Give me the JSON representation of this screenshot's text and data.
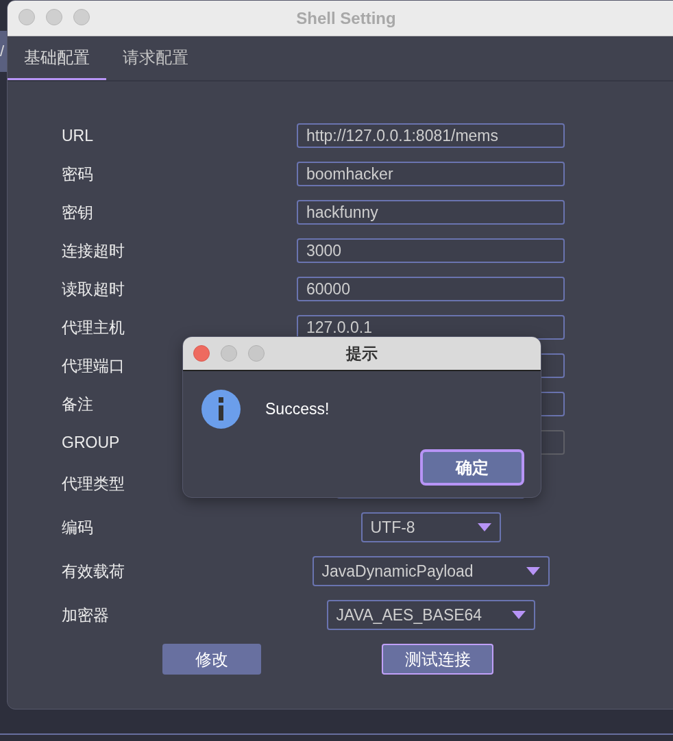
{
  "backdrop": {
    "text": "/"
  },
  "window": {
    "title": "Shell Setting"
  },
  "tabs": [
    {
      "label": "基础配置",
      "selected": true
    },
    {
      "label": "请求配置",
      "selected": false
    }
  ],
  "fields": [
    {
      "kind": "text",
      "label": "URL",
      "value": "http://127.0.0.1:8081/mems",
      "disabled": false
    },
    {
      "kind": "text",
      "label": "密码",
      "value": "boomhacker",
      "disabled": false
    },
    {
      "kind": "text",
      "label": "密钥",
      "value": "hackfunny",
      "disabled": false
    },
    {
      "kind": "text",
      "label": "连接超时",
      "value": "3000",
      "disabled": false
    },
    {
      "kind": "text",
      "label": "读取超时",
      "value": "60000",
      "disabled": false
    },
    {
      "kind": "text",
      "label": "代理主机",
      "value": "127.0.0.1",
      "disabled": false
    },
    {
      "kind": "text",
      "label": "代理端口",
      "disabled": false
    },
    {
      "kind": "text",
      "label": "备注",
      "disabled": false
    },
    {
      "kind": "text",
      "label": "GROUP",
      "disabled": true
    },
    {
      "kind": "select",
      "label": "代理类型"
    },
    {
      "kind": "select",
      "label": "编码",
      "value": "UTF-8"
    },
    {
      "kind": "select",
      "label": "有效载荷",
      "value": "JavaDynamicPayload"
    },
    {
      "kind": "select",
      "label": "加密器",
      "value": "JAVA_AES_BASE64"
    }
  ],
  "buttons": [
    {
      "label": "修改",
      "focused": false
    },
    {
      "label": "测试连接",
      "focused": true
    }
  ],
  "dialog": {
    "title": "提示",
    "message": "Success!",
    "button": {
      "label": "确定",
      "focused": true
    }
  }
}
